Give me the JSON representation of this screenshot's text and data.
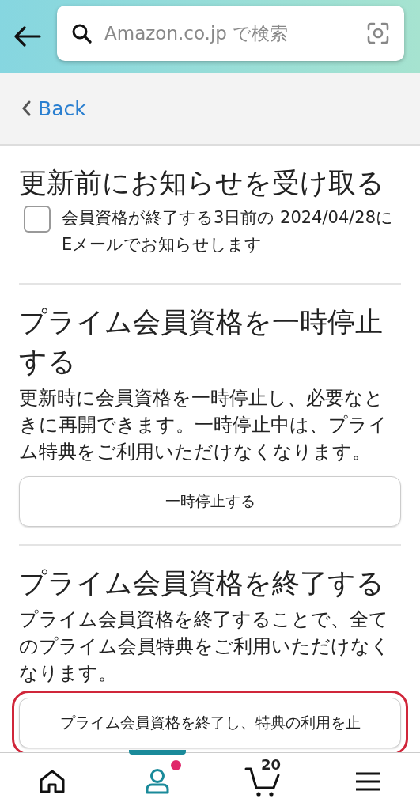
{
  "search": {
    "placeholder": "Amazon.co.jp で検索"
  },
  "back": {
    "label": "Back"
  },
  "notify": {
    "title": "更新前にお知らせを受け取る",
    "checked": false,
    "label": "会員資格が終了する3日前の 2024/04/28にEメールでお知らせします"
  },
  "sections": [
    {
      "title": "プライム会員資格を一時停止する",
      "text": "更新時に会員資格を一時停止し、必要なときに再開できます。一時停止中は、プライム特典をご利用いただけなくなります。",
      "button": "一時停止する",
      "highlighted": false
    },
    {
      "title": "プライム会員資格を終了する",
      "text": "プライム会員資格を終了することで、全てのプライム会員特典をご利用いただけなくなります。",
      "button": "プライム会員資格を終了し、特典の利用を止",
      "highlighted": true
    }
  ],
  "nav": [
    {
      "kind": "home",
      "selected": false
    },
    {
      "kind": "account",
      "selected": true,
      "dot": true
    },
    {
      "kind": "cart",
      "selected": false,
      "count": "20"
    },
    {
      "kind": "menu",
      "selected": false
    }
  ]
}
